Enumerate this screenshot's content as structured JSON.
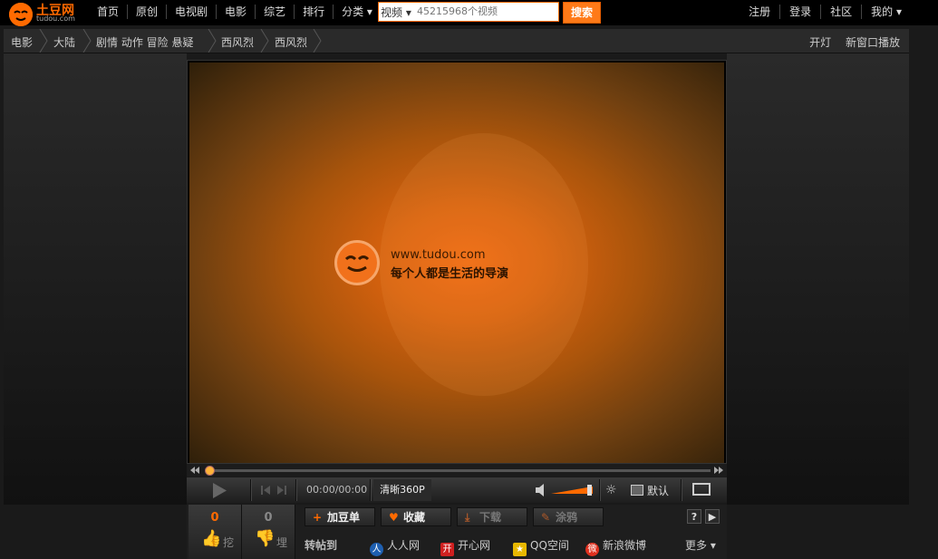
{
  "header": {
    "logo_text": "土豆网",
    "logo_sub": "tudou.com",
    "nav": [
      "首页",
      "原创",
      "电视剧",
      "电影",
      "综艺",
      "排行",
      "分类 ▾"
    ],
    "search_type": "视频 ▾",
    "search_placeholder": "45215968个视频",
    "search_button": "搜索",
    "right": [
      "注册",
      "登录",
      "社区",
      "我的 ▾"
    ]
  },
  "breadcrumb": {
    "items": [
      "电影",
      "大陆",
      "剧情 动作 冒险 悬疑",
      "西风烈",
      "西风烈"
    ],
    "actions": [
      "开灯",
      "新窗口播放"
    ]
  },
  "video": {
    "site_url": "www.tudou.com",
    "slogan": "每个人都是生活的导演"
  },
  "controls": {
    "time": "00:00/00:00",
    "quality": "清晰360P",
    "default_label": "默认",
    "progress_fraction": 0.0,
    "volume_fraction": 0.9
  },
  "interaction": {
    "dig_count": "0",
    "dig_label": "挖",
    "bury_count": "0",
    "bury_label": "埋",
    "actions": [
      "加豆单",
      "收藏",
      "下载",
      "涂鸦"
    ],
    "help": "?",
    "next": "▶",
    "share_label": "转帖到",
    "share_targets": [
      "人人网",
      "开心网",
      "QQ空间",
      "新浪微博"
    ],
    "more": "更多 ▾"
  },
  "colors": {
    "brand": "#ff6a00",
    "background": "#1a1a1a"
  }
}
